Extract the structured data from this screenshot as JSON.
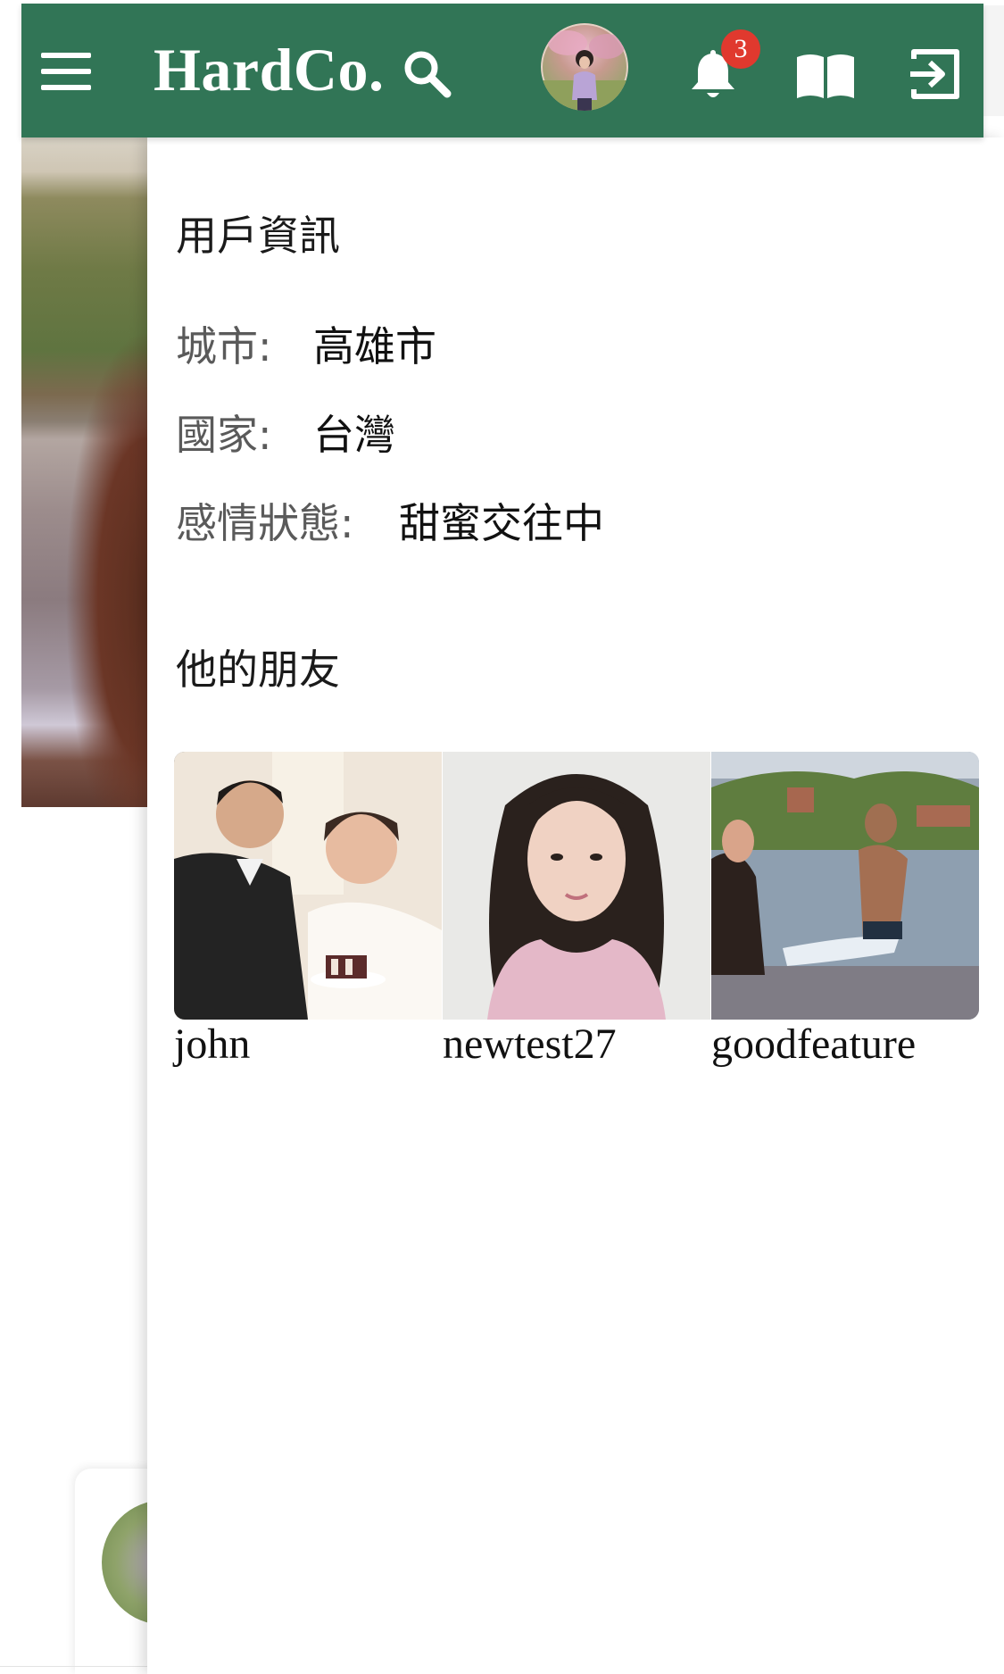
{
  "header": {
    "brand": "HardCo.",
    "notification_count": "3"
  },
  "profile": {
    "section_title": "用戶資訊",
    "fields": [
      {
        "label": "城市:",
        "value": "高雄市"
      },
      {
        "label": "國家:",
        "value": "台灣"
      },
      {
        "label": "感情狀態:",
        "value": "甜蜜交往中"
      }
    ]
  },
  "friends": {
    "section_title": "他的朋友",
    "items": [
      {
        "name": "john"
      },
      {
        "name": "newtest27"
      },
      {
        "name": "goodfeature"
      }
    ]
  },
  "colors": {
    "header_bg": "#317556",
    "badge_bg": "#e0392e"
  },
  "icons": [
    "menu-icon",
    "search-icon",
    "bell-icon",
    "book-icon",
    "logout-icon"
  ]
}
